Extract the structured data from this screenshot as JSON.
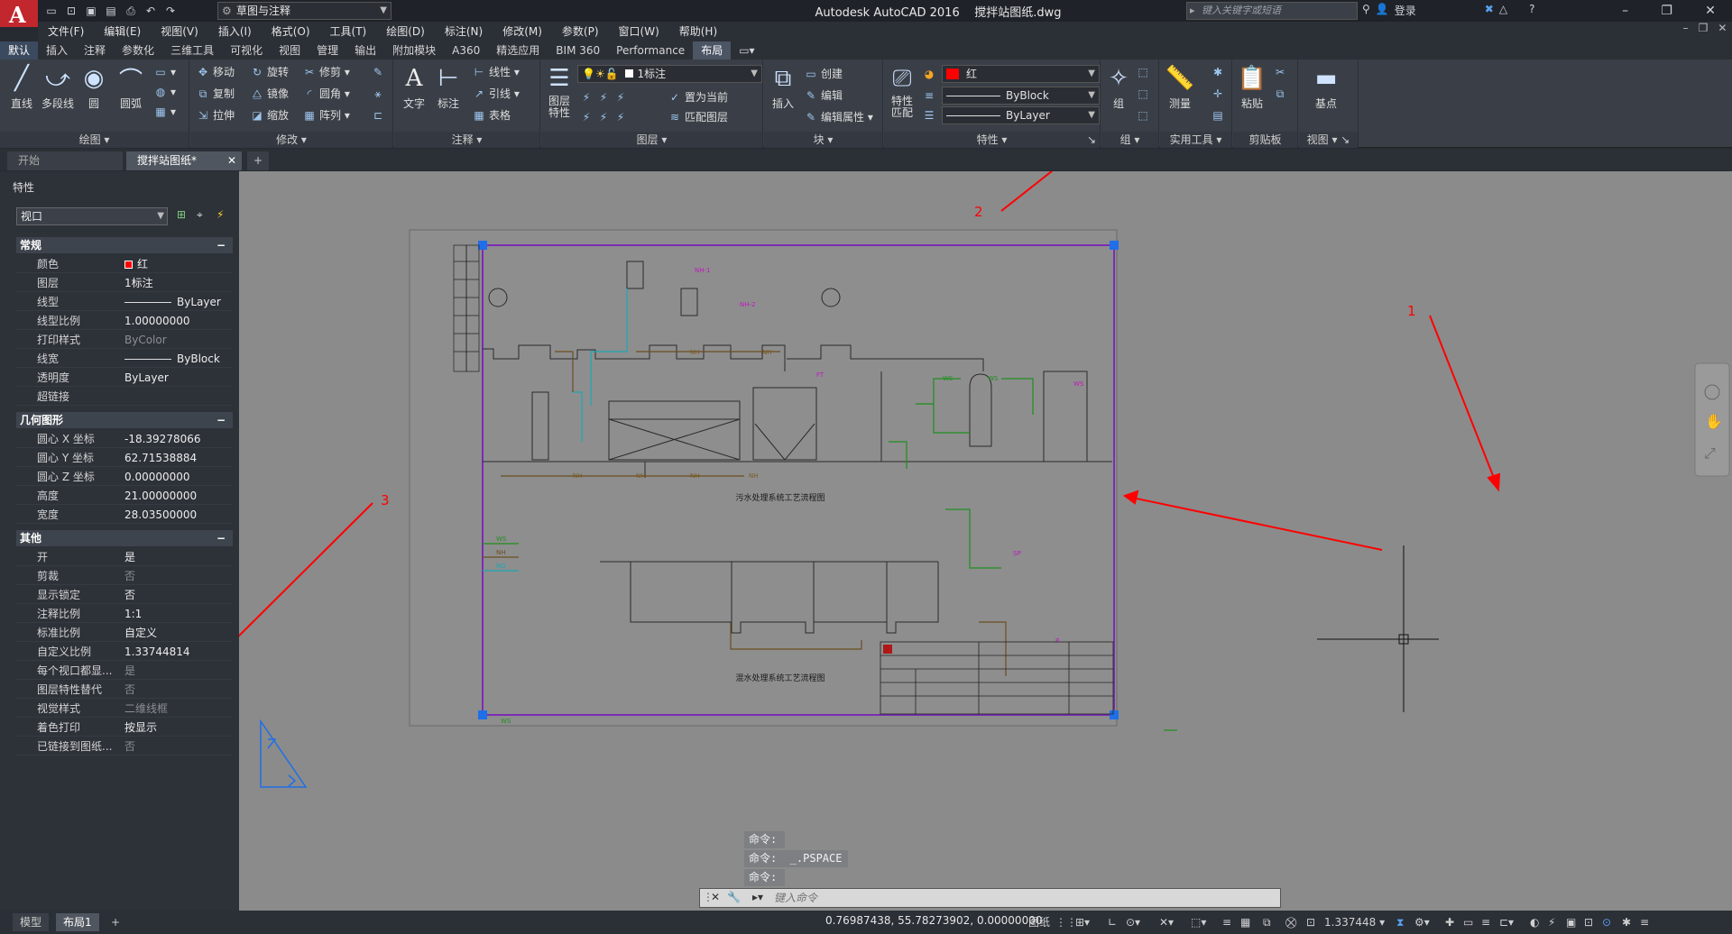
{
  "titlebar": {
    "workspace": "草图与注释",
    "app_title": "Autodesk AutoCAD 2016",
    "file_name": "搅拌站图纸.dwg",
    "search_placeholder": "键入关键字或短语",
    "login_label": "登录"
  },
  "menubar": [
    "文件(F)",
    "编辑(E)",
    "视图(V)",
    "插入(I)",
    "格式(O)",
    "工具(T)",
    "绘图(D)",
    "标注(N)",
    "修改(M)",
    "参数(P)",
    "窗口(W)",
    "帮助(H)"
  ],
  "ribbon_tabs": [
    "默认",
    "插入",
    "注释",
    "参数化",
    "三维工具",
    "可视化",
    "视图",
    "管理",
    "输出",
    "附加模块",
    "A360",
    "精选应用",
    "BIM 360",
    "Performance",
    "布局"
  ],
  "ribbon": {
    "draw": {
      "title": "绘图",
      "line": "直线",
      "polyline": "多段线",
      "circle": "圆",
      "arc": "圆弧"
    },
    "modify": {
      "title": "修改",
      "move": "移动",
      "rotate": "旋转",
      "trim": "修剪",
      "copy": "复制",
      "mirror": "镜像",
      "fillet": "圆角",
      "stretch": "拉伸",
      "scale": "缩放",
      "array": "阵列"
    },
    "annotation": {
      "title": "注释",
      "text": "文字",
      "dimension": "标注",
      "linear": "线性",
      "leader": "引线",
      "table": "表格"
    },
    "layers": {
      "title": "图层",
      "layer_props": "图层\n特性",
      "current_layer": "1标注",
      "make_current": "置为当前",
      "match_layer": "匹配图层"
    },
    "block": {
      "title": "块",
      "insert": "插入",
      "create": "创建",
      "edit": "编辑",
      "edit_attr": "编辑属性"
    },
    "properties": {
      "title": "特性",
      "match": "特性\n匹配",
      "color": "红",
      "linetype": "ByBlock",
      "lineweight": "ByLayer"
    },
    "group": {
      "title": "组",
      "group": "组"
    },
    "utilities": {
      "title": "实用工具",
      "measure": "测量"
    },
    "clipboard": {
      "title": "剪贴板",
      "paste": "粘贴"
    },
    "view": {
      "title": "视图",
      "base": "基点"
    }
  },
  "doc_tabs": [
    "开始",
    "搅拌站图纸*"
  ],
  "properties_palette": {
    "title": "特性",
    "selection": "视口",
    "sections": [
      {
        "name": "常规",
        "rows": [
          {
            "label": "颜色",
            "value": "红",
            "type": "color"
          },
          {
            "label": "图层",
            "value": "1标注"
          },
          {
            "label": "线型",
            "value": "ByLayer",
            "type": "line"
          },
          {
            "label": "线型比例",
            "value": "1.00000000"
          },
          {
            "label": "打印样式",
            "value": "ByColor",
            "dim": true
          },
          {
            "label": "线宽",
            "value": "ByBlock",
            "type": "line"
          },
          {
            "label": "透明度",
            "value": "ByLayer"
          },
          {
            "label": "超链接",
            "value": ""
          }
        ]
      },
      {
        "name": "几何图形",
        "rows": [
          {
            "label": "圆心 X 坐标",
            "value": "-18.39278066"
          },
          {
            "label": "圆心 Y 坐标",
            "value": "62.71538884"
          },
          {
            "label": "圆心 Z 坐标",
            "value": "0.00000000"
          },
          {
            "label": "高度",
            "value": "21.00000000"
          },
          {
            "label": "宽度",
            "value": "28.03500000"
          }
        ]
      },
      {
        "name": "其他",
        "rows": [
          {
            "label": "开",
            "value": "是"
          },
          {
            "label": "剪裁",
            "value": "否",
            "dim": true
          },
          {
            "label": "显示锁定",
            "value": "否"
          },
          {
            "label": "注释比例",
            "value": "1:1"
          },
          {
            "label": "标准比例",
            "value": "自定义"
          },
          {
            "label": "自定义比例",
            "value": "1.33744814"
          },
          {
            "label": "每个视口都显...",
            "value": "是",
            "dim": true
          },
          {
            "label": "图层特性替代",
            "value": "否",
            "dim": true
          },
          {
            "label": "视觉样式",
            "value": "二维线框",
            "dim": true
          },
          {
            "label": "着色打印",
            "value": "按显示"
          },
          {
            "label": "已链接到图纸...",
            "value": "否",
            "dim": true
          }
        ]
      }
    ]
  },
  "drawing": {
    "title_upper": "污水处理系统工艺流程图",
    "title_lower": "混水处理系统工艺流程图",
    "legend": [
      "WS",
      "NH",
      "NQ"
    ],
    "annotations": [
      "1",
      "2",
      "3"
    ]
  },
  "command_history": [
    "命令:",
    "命令:  _.PSPACE",
    "命令:"
  ],
  "command_placeholder": "键入命令",
  "layout_tabs": [
    "模型",
    "布局1"
  ],
  "statusbar": {
    "coordinates": "0.76987438, 55.78273902, 0.00000000",
    "space": "图纸",
    "scale": "1.337448"
  },
  "colors": {
    "accent_red": "#ff0000",
    "viewport_border": "#7b2cb4",
    "grip_blue": "#1e6fe8"
  }
}
